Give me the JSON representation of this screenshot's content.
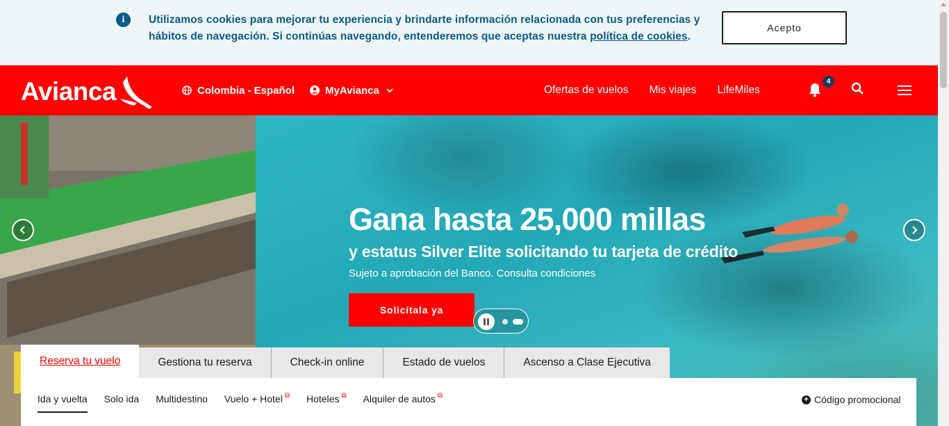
{
  "cookie": {
    "text": "Utilizamos cookies para mejorar tu experiencia y brindarte información relacionada con tus preferencias y hábitos de navegación. Si continúas navegando, entenderemos que aceptas nuestra ",
    "link": "política de cookies",
    "suffix": ".",
    "accept_label": "Acepto",
    "info_icon": "info-icon"
  },
  "header": {
    "logo": "Avianca",
    "country": "Colombia - Español",
    "account": "MyAvianca",
    "links": [
      "Ofertas de vuelos",
      "Mis viajes",
      "LifeMiles"
    ],
    "notifications": "4",
    "brand_color": "#ff0000"
  },
  "hero": {
    "title": "Gana hasta 25,000 millas",
    "subtitle": "y estatus Silver Elite solicitando tu tarjeta de crédito",
    "note": "Sujeto a aprobación del Banco. Consulta condiciones",
    "cta": "Solicítala ya"
  },
  "booking": {
    "tabs": [
      "Reserva tu vuelo",
      "Gestiona tu reserva",
      "Check-in online",
      "Estado de vuelos",
      "Ascenso a Clase Ejecutiva"
    ],
    "subtabs": [
      "Ida y vuelta",
      "Solo ida",
      "Multidestino",
      "Vuelo + Hotel",
      "Hoteles",
      "Alquiler de autos"
    ],
    "promo": "Código promocional"
  }
}
